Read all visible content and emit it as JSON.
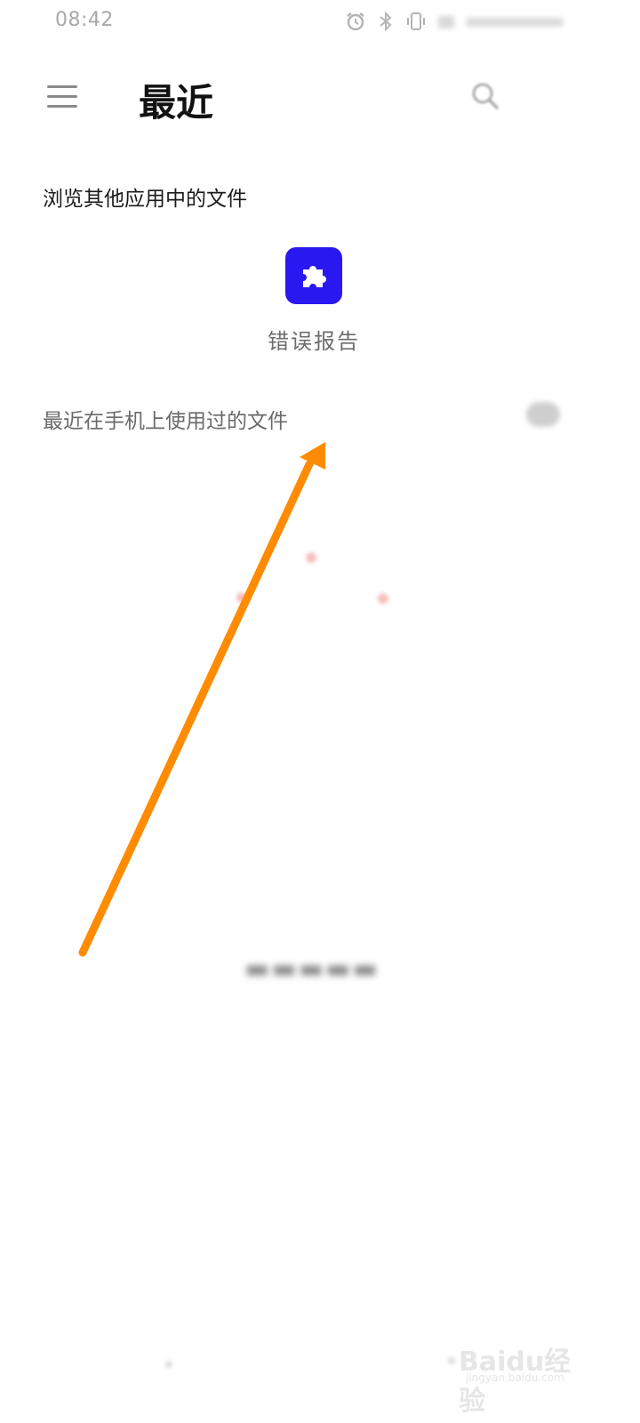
{
  "status_bar": {
    "time": "08:42",
    "icons": [
      "alarm-icon",
      "bluetooth-icon",
      "vibrate-icon",
      "signal-icon",
      "battery-icon"
    ]
  },
  "header": {
    "title": "最近",
    "menu_icon": "hamburger-icon",
    "search_icon": "search-icon"
  },
  "browse_section": {
    "title": "浏览其他应用中的文件",
    "apps": [
      {
        "label": "错误报告",
        "icon": "puzzle-icon",
        "color": "#2a18f0"
      }
    ]
  },
  "recent_section": {
    "title": "最近在手机上使用过的文件"
  },
  "annotation": {
    "color": "#ff8c00"
  },
  "watermark": {
    "text": "Baidu经验",
    "sub": "jingyan.baidu.com"
  }
}
